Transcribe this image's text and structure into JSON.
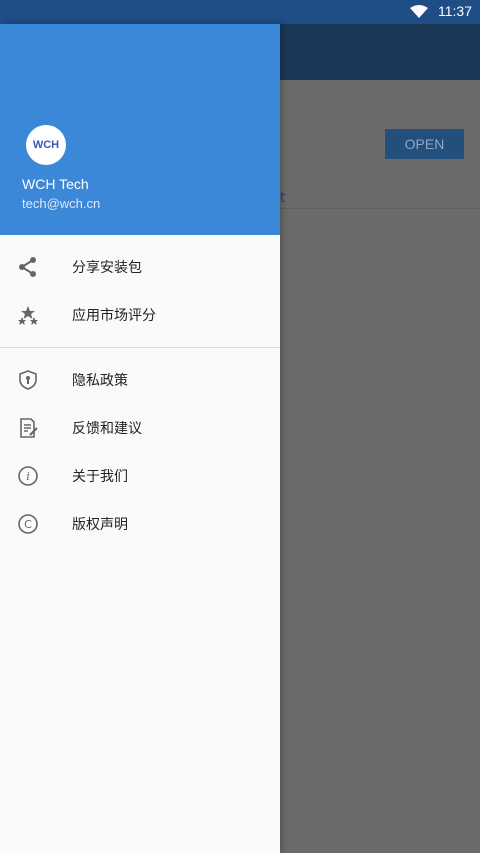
{
  "status": {
    "time": "11:37"
  },
  "background": {
    "open_button_label": "OPEN",
    "ghost_text": "t"
  },
  "drawer": {
    "header": {
      "logo_text": "WCH",
      "user_name": "WCH Tech",
      "user_email": "tech@wch.cn"
    },
    "menu": {
      "group1": [
        {
          "label": "分享安装包",
          "icon": "share-icon"
        },
        {
          "label": "应用市场评分",
          "icon": "stars-icon"
        }
      ],
      "group2": [
        {
          "label": "隐私政策",
          "icon": "shield-icon"
        },
        {
          "label": "反馈和建议",
          "icon": "feedback-icon"
        },
        {
          "label": "关于我们",
          "icon": "info-icon"
        },
        {
          "label": "版权声明",
          "icon": "copyright-icon"
        }
      ]
    }
  },
  "colors": {
    "header": "#3b88d8",
    "statusbar": "#1f4d86",
    "appbar": "#1b3757",
    "scrim": "#6b6b6b"
  }
}
